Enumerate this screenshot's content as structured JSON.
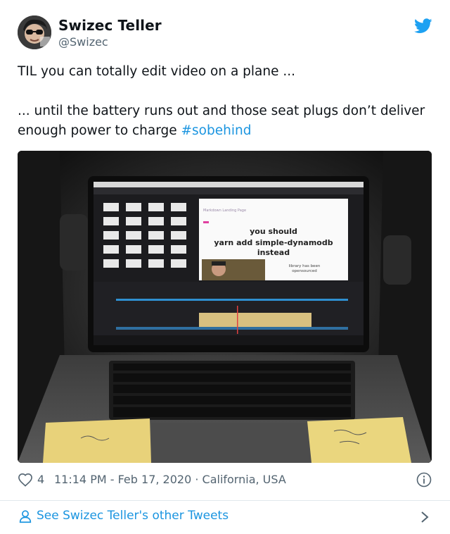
{
  "user": {
    "name": "Swizec Teller",
    "handle": "@Swizec"
  },
  "tweet": {
    "line1": "TIL you can totally edit video on a plane ...",
    "line2_part1": "... until the battery runs out and those seat plugs don’t deliver enough power to charge ",
    "hashtag": "#sobehind"
  },
  "media": {
    "screen_slide_heading": "Markdown Landing Page",
    "screen_slide_text_1": "you should",
    "screen_slide_text_2": "yarn add simple-dynamodb",
    "screen_slide_text_3": "instead",
    "screen_slide_note_1": "library has been",
    "screen_slide_note_2": "opensourced"
  },
  "meta": {
    "like_count": "4",
    "timestamp": "11:14 PM - Feb 17, 2020 · California, USA"
  },
  "footer": {
    "link_text": "See Swizec Teller's other Tweets"
  },
  "icons": {
    "twitter": "twitter-bird-icon",
    "like": "heart-icon",
    "info": "info-icon",
    "user": "user-icon",
    "chevron": "chevron-right-icon"
  },
  "colors": {
    "brand_blue": "#1da1f2",
    "link_blue": "#1b95e0",
    "text": "#0f1419",
    "secondary": "#536471"
  }
}
